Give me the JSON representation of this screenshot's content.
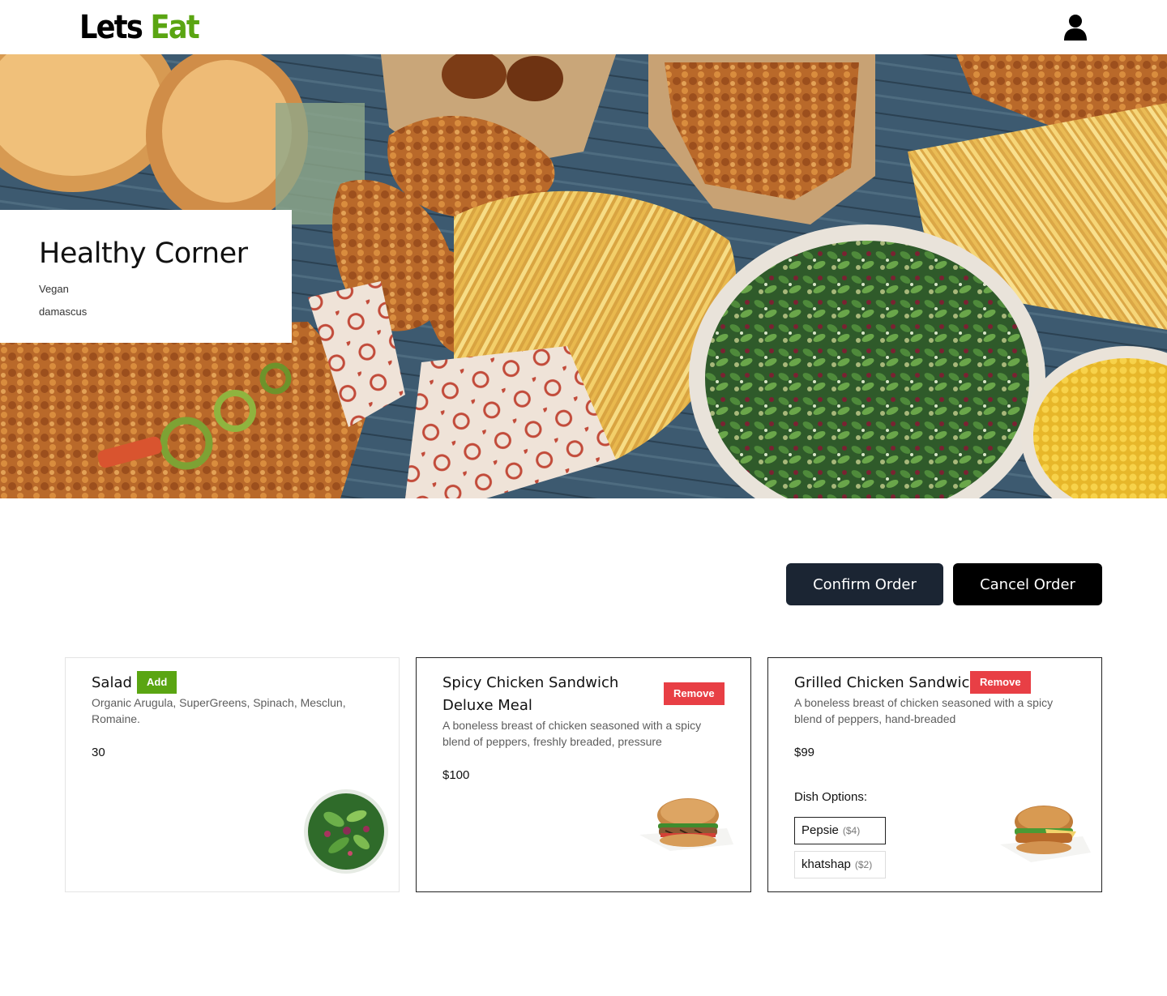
{
  "header": {
    "logo_word1": "Lets",
    "logo_word2": "Eat",
    "user_icon": "user-icon"
  },
  "restaurant": {
    "name": "Healthy Corner",
    "category": "Vegan",
    "location": "damascus"
  },
  "actions": {
    "confirm_label": "Confirm Order",
    "cancel_label": "Cancel Order"
  },
  "dishes": [
    {
      "title": "Salad",
      "action_label": "Add",
      "description": "Organic Arugula, SuperGreens, Spinach, Mesclun, Romaine.",
      "price": "30",
      "image": "salad-bowl"
    },
    {
      "title": "Spicy Chicken Sandwich Deluxe Meal",
      "action_label": "Remove",
      "description": "A boneless breast of chicken seasoned with a spicy blend of peppers, freshly breaded, pressure",
      "price": "$100",
      "image": "grilled-sandwich"
    },
    {
      "title": "Grilled Chicken Sandwich",
      "action_label": "Remove",
      "description": "A boneless breast of chicken seasoned with a spicy blend of peppers, hand-breaded",
      "price": "$99",
      "image": "chicken-sandwich",
      "options_label": "Dish Options:",
      "options": [
        {
          "name": "Pepsie",
          "price": "($4)",
          "selected": true
        },
        {
          "name": "khatshap",
          "price": "($2)",
          "selected": false
        }
      ]
    }
  ],
  "colors": {
    "brand_green": "#5aa512",
    "remove_red": "#e83f45",
    "confirm_bg": "#1b2533",
    "cancel_bg": "#000000"
  }
}
